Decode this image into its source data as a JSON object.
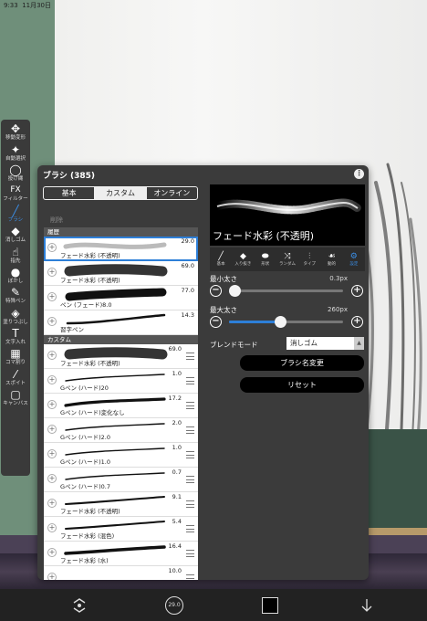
{
  "status_bar": {
    "time": "9:33",
    "date": "11月30日"
  },
  "toolbar": [
    {
      "icon": "move-transform-icon",
      "glyph": "✥",
      "label": "移動変形"
    },
    {
      "icon": "auto-select-icon",
      "glyph": "✦",
      "label": "自動選択"
    },
    {
      "icon": "lasso-icon",
      "glyph": "◯",
      "label": "投げ縄"
    },
    {
      "icon": "filter-icon",
      "glyph": "FX",
      "label": "フィルター"
    },
    {
      "icon": "brush-icon",
      "glyph": "╱",
      "label": "ブラシ",
      "active": true
    },
    {
      "icon": "eraser-icon",
      "glyph": "◆",
      "label": "消しゴム"
    },
    {
      "icon": "smudge-icon",
      "glyph": "☝",
      "label": "指先"
    },
    {
      "icon": "blur-icon",
      "glyph": "●",
      "label": "ぼかし"
    },
    {
      "icon": "special-pen-icon",
      "glyph": "✎",
      "label": "特殊ペン"
    },
    {
      "icon": "fill-bucket-icon",
      "glyph": "◈",
      "label": "塗りつぶし"
    },
    {
      "icon": "text-icon",
      "glyph": "T",
      "label": "文字入れ"
    },
    {
      "icon": "frame-divide-icon",
      "glyph": "▦",
      "label": "コマ割り"
    },
    {
      "icon": "eyedropper-icon",
      "glyph": "⁄",
      "label": "スポイト"
    },
    {
      "icon": "canvas-icon",
      "glyph": "▢",
      "label": "キャンバス"
    }
  ],
  "panel": {
    "title": "ブラシ (385)",
    "menu_glyph": "⋮",
    "tabs": [
      {
        "label": "基本",
        "selected": false
      },
      {
        "label": "カスタム",
        "selected": true
      },
      {
        "label": "オンライン",
        "selected": false
      }
    ],
    "delete_label": "削除",
    "sections": [
      {
        "title": "履歴",
        "brushes": [
          {
            "name": "フェード水彩 (不透明)",
            "value": "29.0",
            "stroke": "fade",
            "selected": true,
            "handle": false
          },
          {
            "name": "フェード水彩 (不透明)",
            "value": "69.0",
            "stroke": "blob",
            "handle": false
          },
          {
            "name": "ペン (フェード)8.0",
            "value": "77.0",
            "stroke": "thick",
            "handle": false
          },
          {
            "name": "習字ペン",
            "value": "14.3",
            "stroke": "brushpen",
            "handle": false
          }
        ]
      },
      {
        "title": "カスタム",
        "brushes": [
          {
            "name": "フェード水彩 (不透明)",
            "value": "69.0",
            "stroke": "blob",
            "handle": true
          },
          {
            "name": "Gペン (ハード)20",
            "value": "1.0",
            "stroke": "thin",
            "handle": true
          },
          {
            "name": "Gペン (ハード)変化なし",
            "value": "17.2",
            "stroke": "bold",
            "handle": true
          },
          {
            "name": "Gペン (ハード)2.0",
            "value": "2.0",
            "stroke": "thin",
            "handle": true
          },
          {
            "name": "Gペン (ハード)1.0",
            "value": "1.0",
            "stroke": "thin",
            "handle": true
          },
          {
            "name": "Gペン (ハード)0.7",
            "value": "0.7",
            "stroke": "thin",
            "handle": true
          },
          {
            "name": "フェード水彩 (不透明)",
            "value": "9.1",
            "stroke": "taper",
            "handle": true
          },
          {
            "name": "フェード水彩 (混色)",
            "value": "5.4",
            "stroke": "taper",
            "handle": true
          },
          {
            "name": "フェード水彩 (水)",
            "value": "16.4",
            "stroke": "taper2",
            "handle": true
          },
          {
            "name": "",
            "value": "10.0",
            "stroke": "none",
            "handle": true
          }
        ]
      }
    ],
    "preview": {
      "name": "フェード水彩 (不透明)"
    },
    "categories": [
      {
        "icon": "basic-brush-icon",
        "glyph": "╱",
        "label": "基本"
      },
      {
        "icon": "entry-exit-icon",
        "glyph": "◆",
        "label": "入り抜き"
      },
      {
        "icon": "shape-icon",
        "glyph": "⬬",
        "label": "形状"
      },
      {
        "icon": "random-icon",
        "glyph": "⤨",
        "label": "ランダム"
      },
      {
        "icon": "type-icon",
        "glyph": "⫶",
        "label": "タイプ"
      },
      {
        "icon": "dynamics-icon",
        "glyph": "☙",
        "label": "動的"
      },
      {
        "icon": "settings-icon",
        "glyph": "⚙",
        "label": "設定",
        "selected": true
      }
    ],
    "min_size": {
      "label": "最小太さ",
      "value": "0.3px",
      "fraction": 0.0
    },
    "max_size": {
      "label": "最大太さ",
      "value": "260px",
      "fraction": 0.45
    },
    "blend": {
      "label": "ブレンドモード",
      "value": "消しゴム",
      "arrow": "▲"
    },
    "rename_button": "ブラシ名変更",
    "reset_button": "リセット",
    "minus": "−",
    "plus": "+"
  },
  "bottom_bar": {
    "items": [
      {
        "icon": "transform-icon"
      },
      {
        "icon": "brush-size-icon"
      },
      {
        "icon": "color-icon"
      },
      {
        "icon": "layers-down-icon"
      }
    ],
    "brush_size_value": "29.0"
  },
  "colors": {
    "accent": "#2d7fd8",
    "panel": "#3b3b3b",
    "toolbar": "#3a3a3a",
    "board": "#3a5347"
  }
}
